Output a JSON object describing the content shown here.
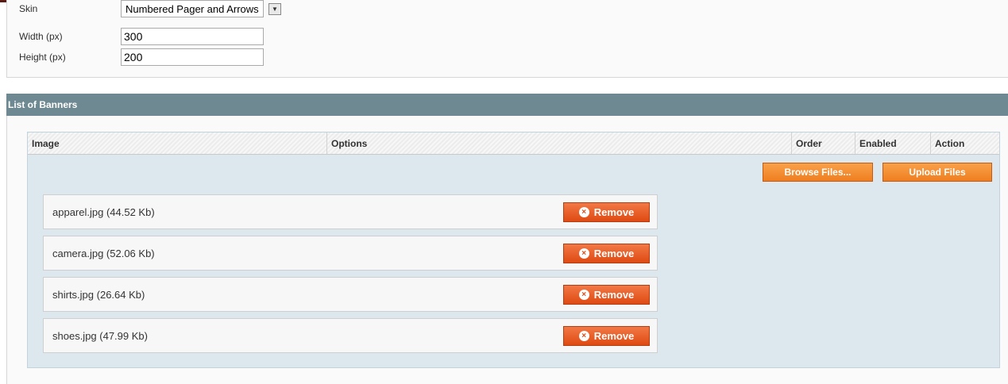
{
  "settings": {
    "skin": {
      "label": "Skin",
      "value": "Numbered Pager and Arrows"
    },
    "width": {
      "label": "Width (px)",
      "value": "300"
    },
    "height": {
      "label": "Height (px)",
      "value": "200"
    }
  },
  "banners": {
    "title": "List of Banners",
    "columns": [
      "Image",
      "Options",
      "Order",
      "Enabled",
      "Action"
    ],
    "browse_label": "Browse Files...",
    "upload_label": "Upload Files",
    "remove_label": "Remove",
    "files": [
      "apparel.jpg (44.52 Kb)",
      "camera.jpg (52.06 Kb)",
      "shirts.jpg (26.64 Kb)",
      "shoes.jpg (47.99 Kb)"
    ]
  },
  "colors": {
    "header_bar": "#6f8992",
    "grid_bg": "#dce7ee",
    "orange_button": "#ef7e1f",
    "remove_button": "#df4a12"
  }
}
